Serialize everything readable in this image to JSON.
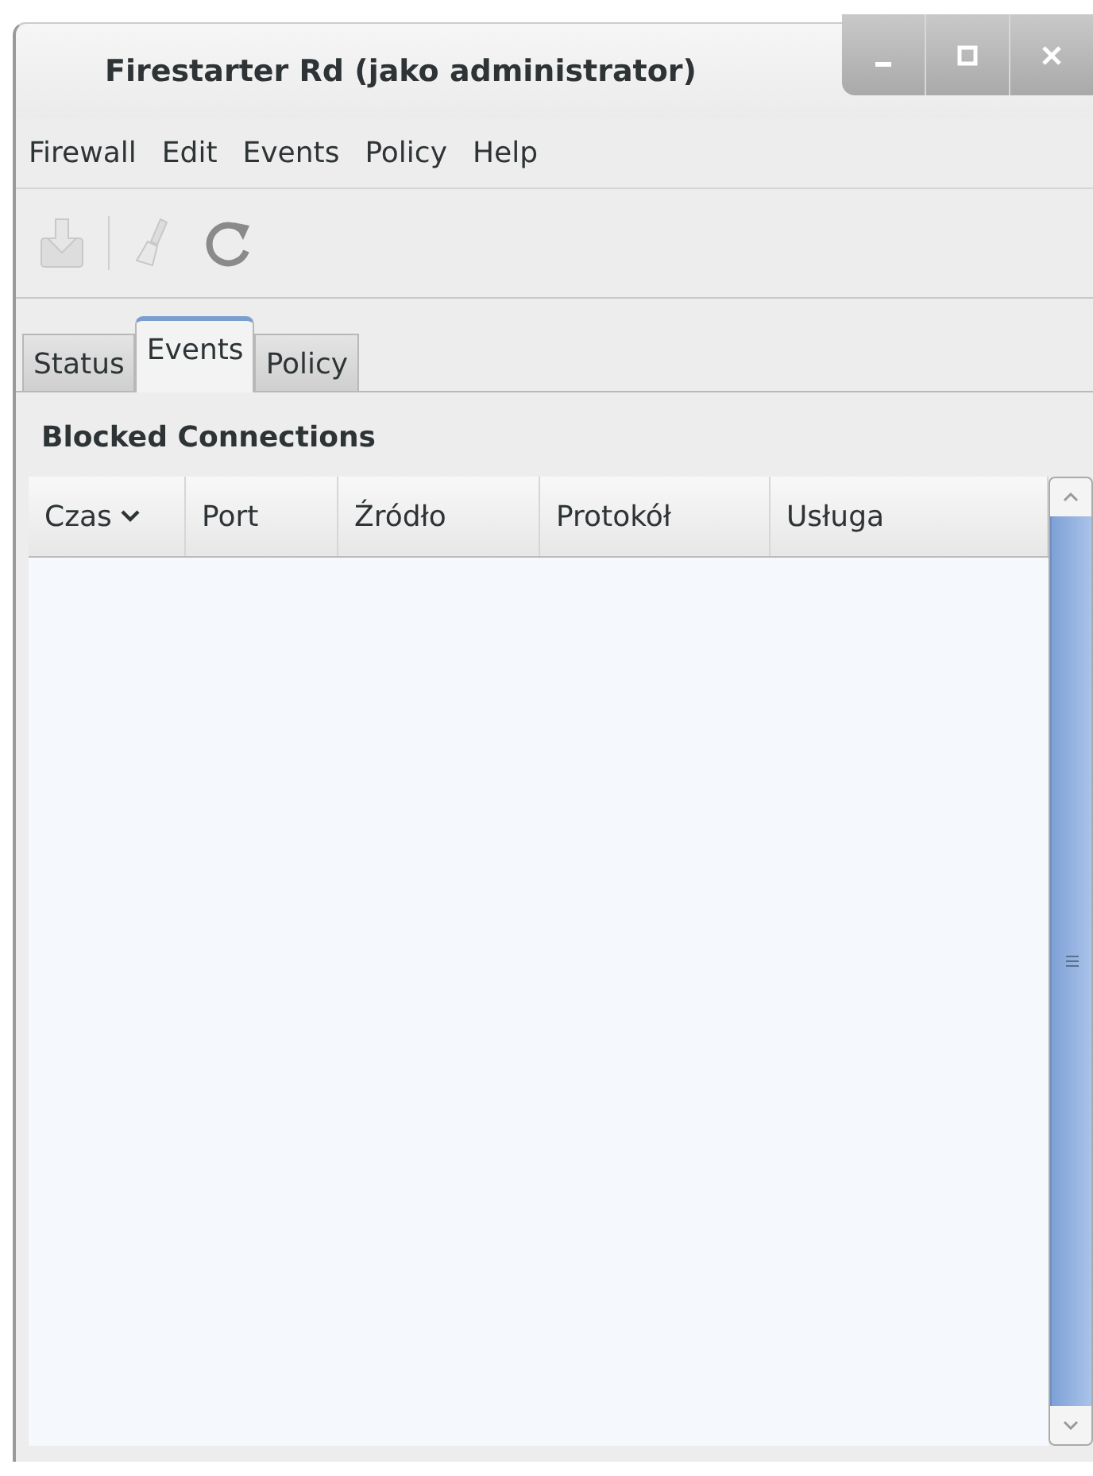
{
  "window": {
    "title": "Firestarter Rd (jako administrator)"
  },
  "menu": [
    "Firewall",
    "Edit",
    "Events",
    "Policy",
    "Help"
  ],
  "toolbar": [
    {
      "kind": "save",
      "disabled": true
    },
    {
      "kind": "clear",
      "disabled": true
    },
    {
      "kind": "refresh",
      "disabled": false
    }
  ],
  "tabs": [
    {
      "label": "Status",
      "selected": false
    },
    {
      "label": "Events",
      "selected": true
    },
    {
      "label": "Policy",
      "selected": false
    }
  ],
  "section_title": "Blocked Connections",
  "table": {
    "columns": [
      {
        "label": "Czas",
        "sorted": true
      },
      {
        "label": "Port",
        "sorted": false
      },
      {
        "label": "Źródło",
        "sorted": false
      },
      {
        "label": "Protokół",
        "sorted": false
      },
      {
        "label": "Usługa",
        "sorted": false
      }
    ]
  }
}
